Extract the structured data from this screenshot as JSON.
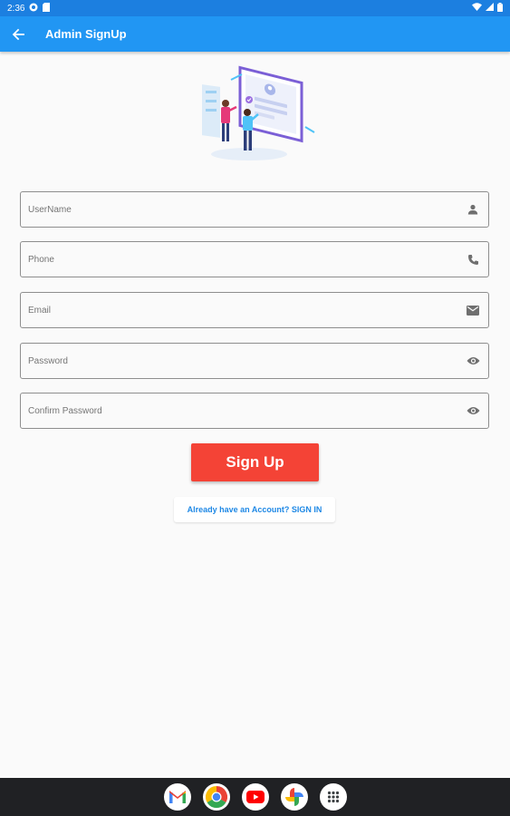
{
  "status_bar": {
    "time": "2:36"
  },
  "app_bar": {
    "title": "Admin SignUp"
  },
  "form": {
    "fields": [
      {
        "label": "UserName",
        "icon": "person-icon"
      },
      {
        "label": "Phone",
        "icon": "phone-icon"
      },
      {
        "label": "Email",
        "icon": "email-icon"
      },
      {
        "label": "Password",
        "icon": "eye-icon"
      },
      {
        "label": "Confirm Password",
        "icon": "eye-icon"
      }
    ],
    "signup_label": "Sign Up",
    "signin_link": "Already have an Account? SIGN IN"
  },
  "dock": {
    "apps": [
      "gmail-icon",
      "chrome-icon",
      "youtube-icon",
      "photos-icon",
      "apps-icon"
    ]
  },
  "colors": {
    "primary": "#2196f3",
    "status_bar": "#1c7fe0",
    "button": "#f44336",
    "link": "#1e88e5"
  }
}
